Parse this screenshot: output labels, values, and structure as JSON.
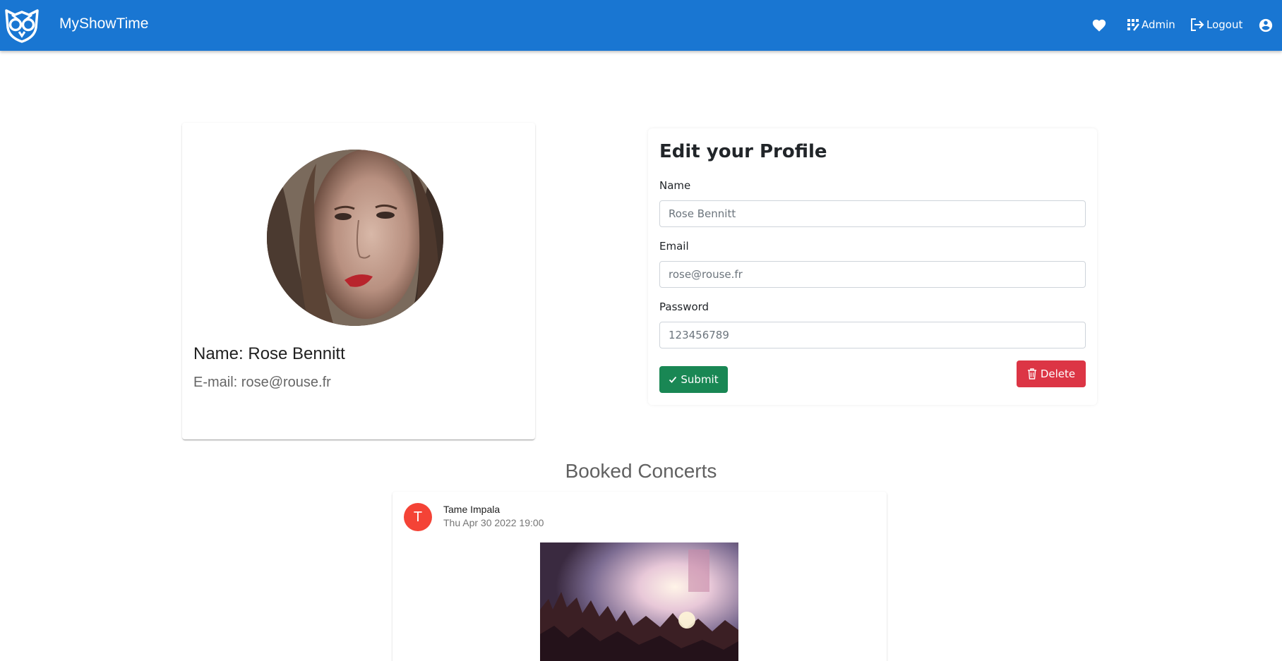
{
  "navbar": {
    "brand": "MyShowTime",
    "admin_label": "Admin",
    "logout_label": "Logout",
    "color": "#1976d2"
  },
  "profile": {
    "name_text": "Name: Rose Bennitt",
    "email_text": "E-mail: rose@rouse.fr"
  },
  "edit_form": {
    "title": "Edit your Profile",
    "name_label": "Name",
    "name_value": "Rose Bennitt",
    "email_label": "Email",
    "email_value": "rose@rouse.fr",
    "password_label": "Password",
    "password_value": "123456789",
    "submit_label": "Submit",
    "delete_label": "Delete"
  },
  "booked": {
    "title": "Booked Concerts",
    "concerts": [
      {
        "initial": "T",
        "name": "Tame Impala",
        "date": "Thu Apr 30 2022 19:00"
      }
    ]
  }
}
